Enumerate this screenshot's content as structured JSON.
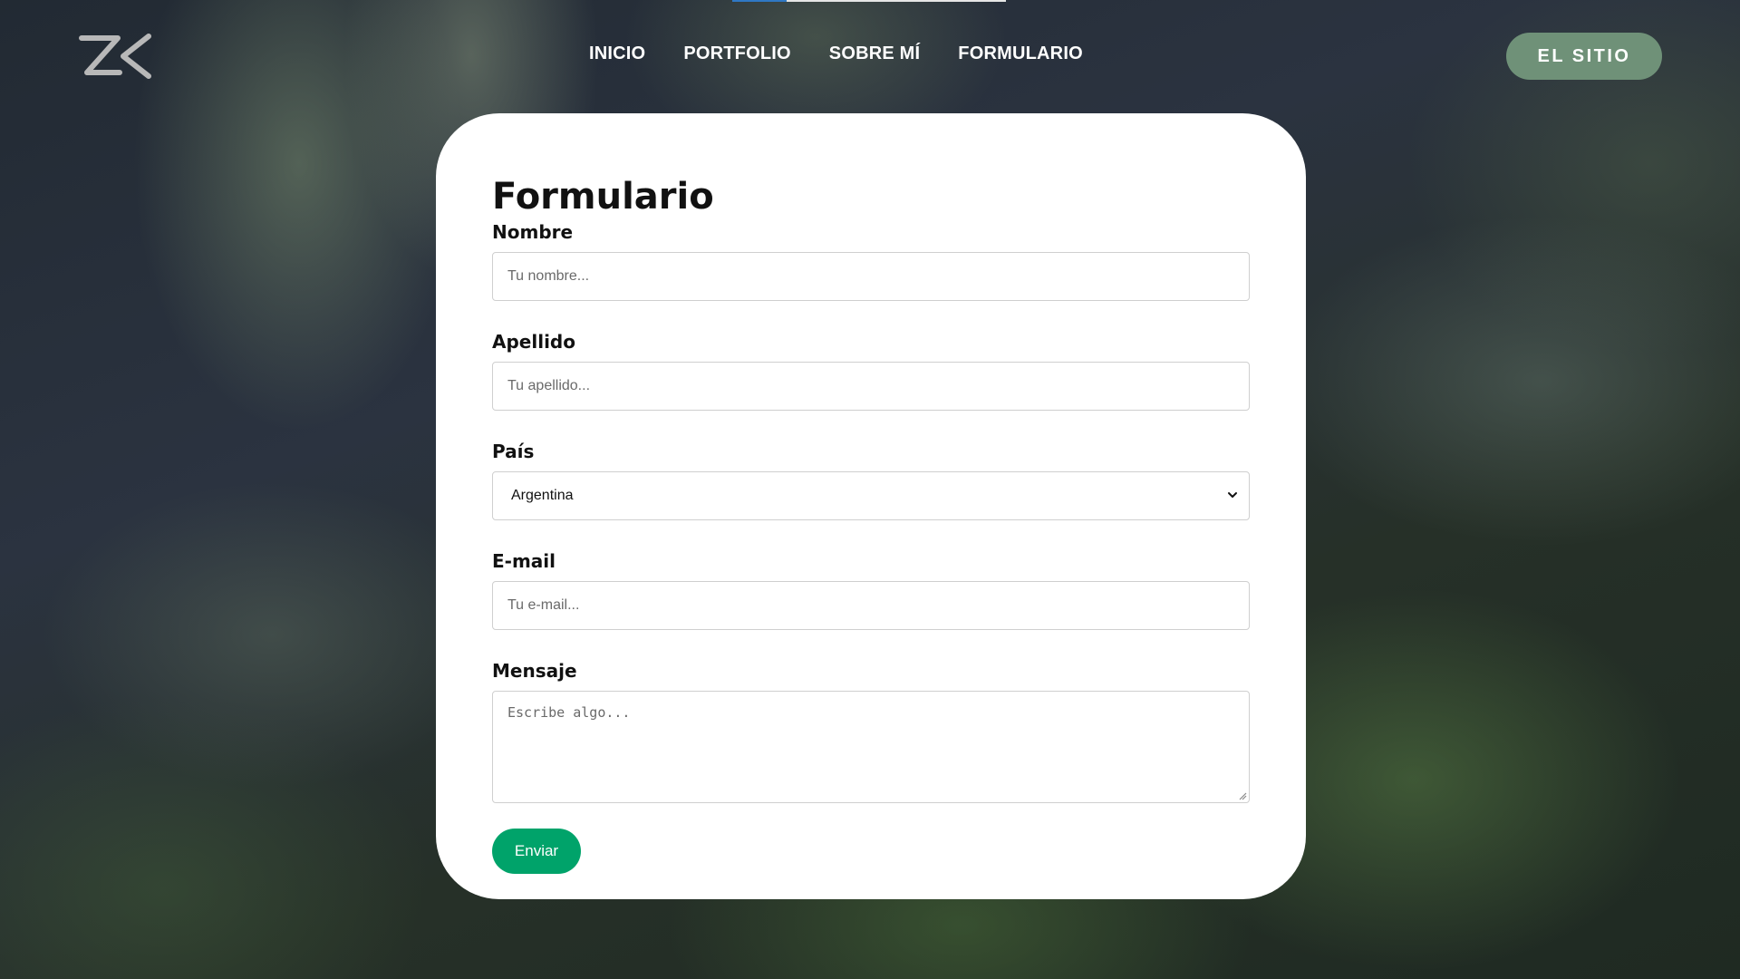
{
  "header": {
    "logo_icon": "zk-logo-icon",
    "nav": [
      {
        "label": "INICIO"
      },
      {
        "label": "PORTFOLIO"
      },
      {
        "label": "SOBRE MÍ"
      },
      {
        "label": "FORMULARIO"
      }
    ],
    "cta_label": "EL SITIO"
  },
  "form": {
    "title": "Formulario",
    "fields": {
      "nombre": {
        "label": "Nombre",
        "placeholder": "Tu nombre..."
      },
      "apellido": {
        "label": "Apellido",
        "placeholder": "Tu apellido..."
      },
      "pais": {
        "label": "País",
        "selected": "Argentina",
        "icon": "chevron-down-icon"
      },
      "email": {
        "label": "E-mail",
        "placeholder": "Tu e-mail..."
      },
      "mensaje": {
        "label": "Mensaje",
        "placeholder": "Escribe algo..."
      }
    },
    "submit_label": "Enviar"
  },
  "colors": {
    "cta_bg": "#6f9178",
    "submit_bg": "#00a36a",
    "progress_accent": "#2f78c4"
  }
}
